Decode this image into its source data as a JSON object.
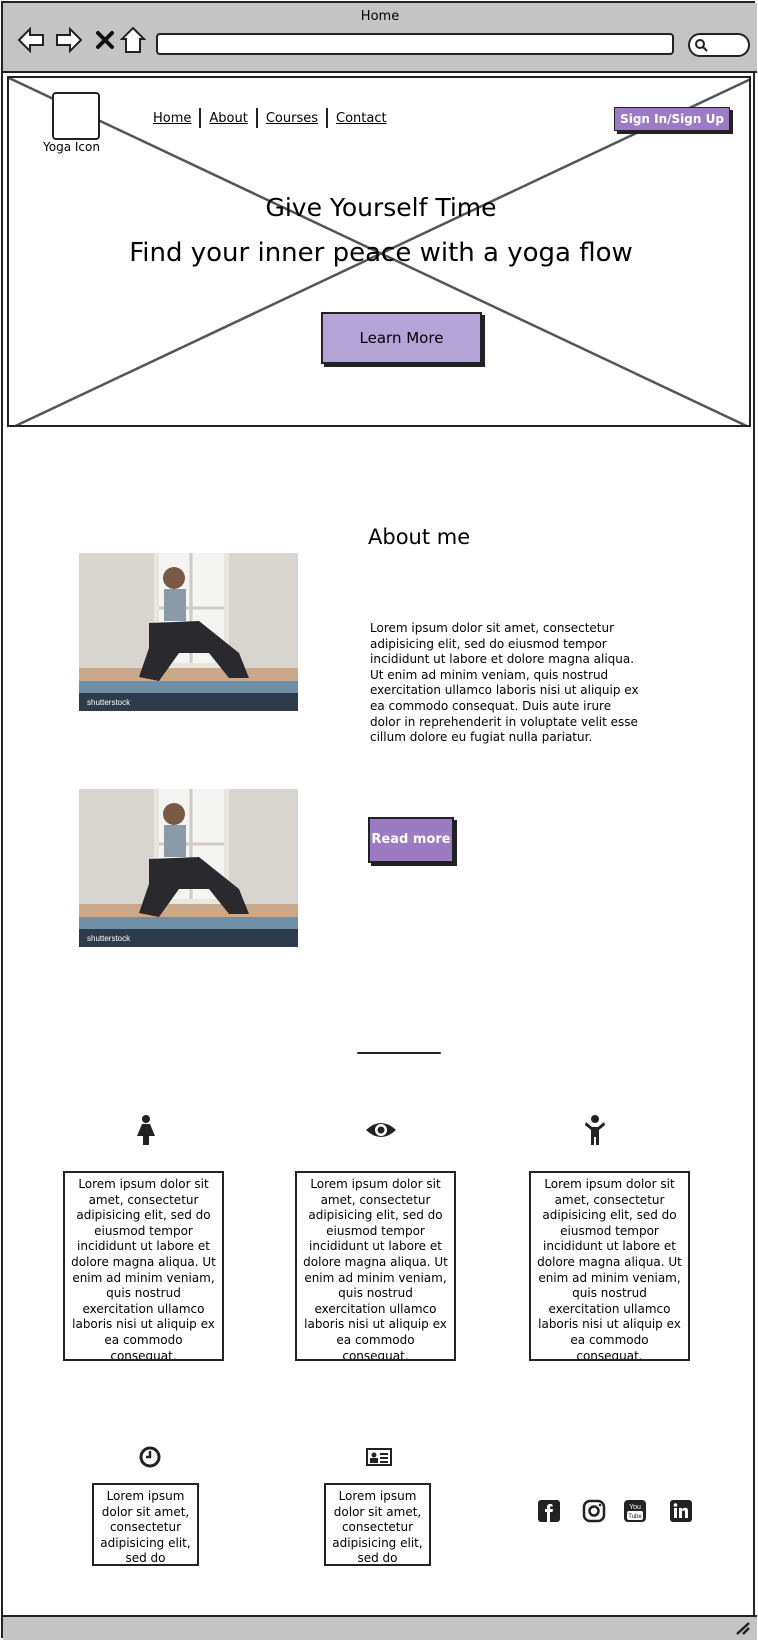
{
  "browser": {
    "title": "Home"
  },
  "hero": {
    "logo_label": "Yoga Icon",
    "nav": [
      "Home",
      "About",
      "Courses",
      "Contact"
    ],
    "signin_label": "Sign In/Sign Up",
    "headline": "Give Yourself Time",
    "subheadline": "Find your inner peace with a yoga flow",
    "cta_label": "Learn More"
  },
  "about": {
    "title": "About me",
    "text": "Lorem ipsum dolor sit amet, consectetur adipisicing elit, sed do eiusmod tempor incididunt ut labore et dolore magna aliqua. Ut enim ad minim veniam, quis nostrud exercitation ullamco laboris nisi ut aliquip ex ea commodo consequat. Duis aute irure dolor in reprehenderit in voluptate velit esse cillum dolore eu fugiat nulla pariatur.",
    "read_more_label": "Read more",
    "photo_watermark": "shutterstock"
  },
  "features": [
    {
      "icon": "female-person-icon",
      "text": "Lorem ipsum dolor sit amet, consectetur adipisicing elit, sed do eiusmod tempor incididunt ut labore et dolore magna aliqua. Ut enim ad minim veniam, quis nostrud exercitation ullamco laboris nisi ut aliquip ex ea commodo consequat."
    },
    {
      "icon": "eye-icon",
      "text": "Lorem ipsum dolor sit amet, consectetur adipisicing elit, sed do eiusmod tempor incididunt ut labore et dolore magna aliqua. Ut enim ad minim veniam, quis nostrud exercitation ullamco laboris nisi ut aliquip ex ea commodo consequat."
    },
    {
      "icon": "child-icon",
      "text": "Lorem ipsum dolor sit amet, consectetur adipisicing elit, sed do eiusmod tempor incididunt ut labore et dolore magna aliqua. Ut enim ad minim veniam, quis nostrud exercitation ullamco laboris nisi ut aliquip ex ea commodo consequat."
    }
  ],
  "extras": [
    {
      "icon": "clock-icon",
      "text": "Lorem ipsum dolor sit amet, consectetur adipisicing elit, sed do eiusmod"
    },
    {
      "icon": "id-card-icon",
      "text": "Lorem ipsum dolor sit amet, consectetur adipisicing elit, sed do eiusmod"
    }
  ],
  "social": [
    "facebook-icon",
    "instagram-icon",
    "youtube-icon",
    "linkedin-icon"
  ],
  "colors": {
    "accent": "#9a7bc4",
    "accent_light": "#b3a3d6",
    "chrome": "#c4c4c4"
  }
}
